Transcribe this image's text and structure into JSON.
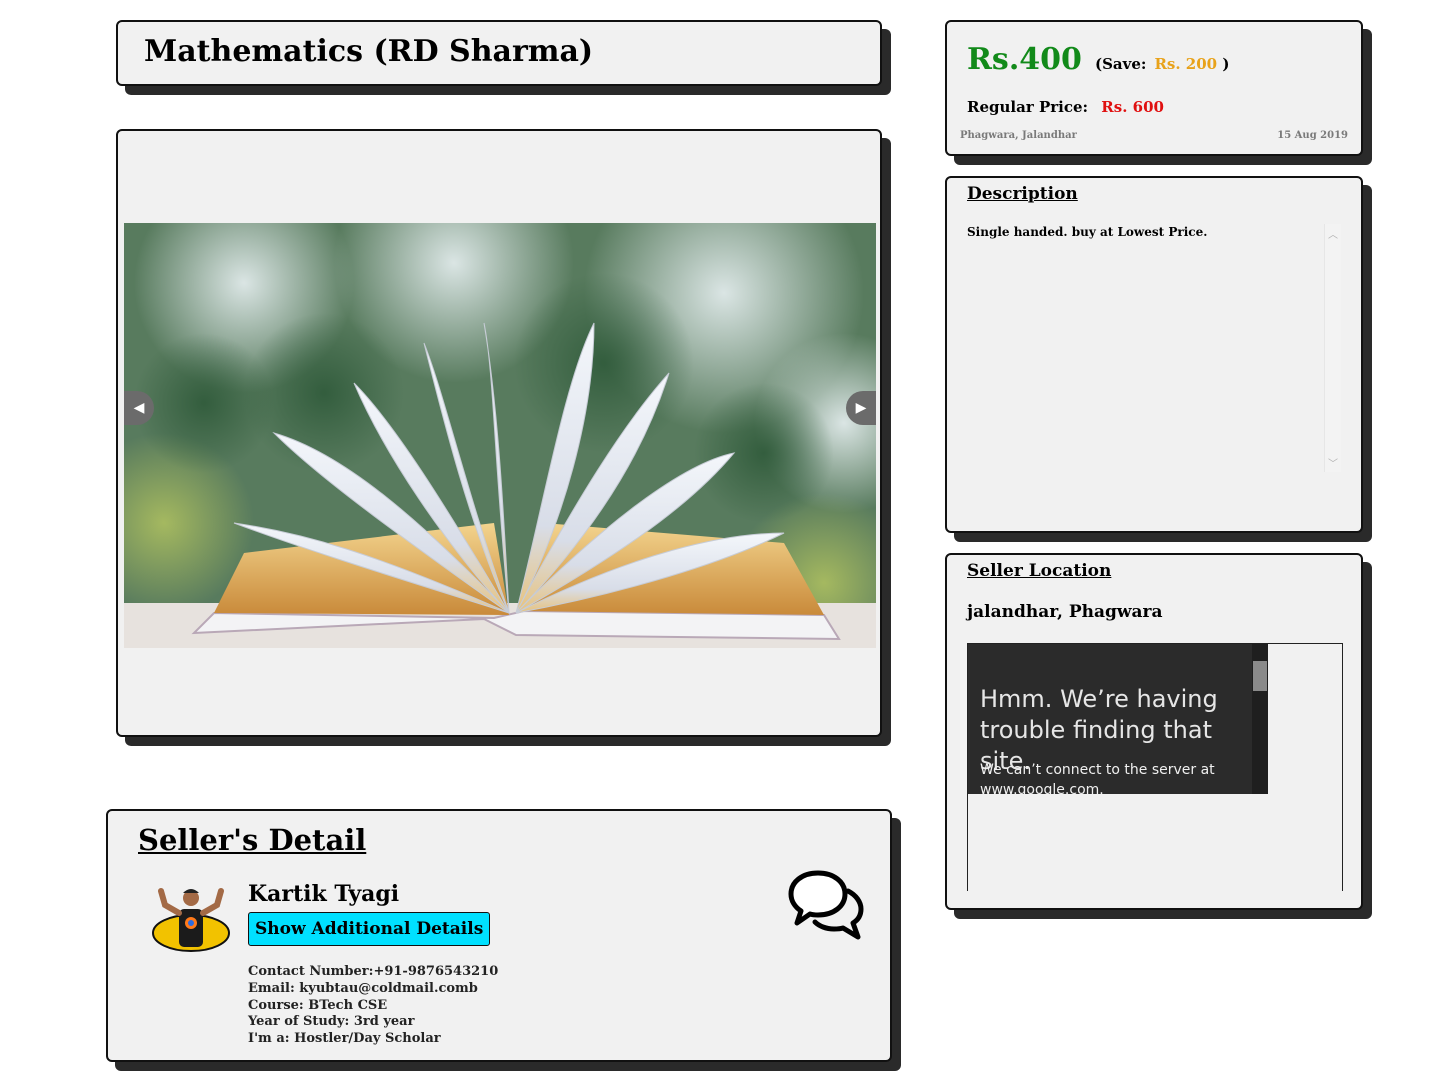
{
  "listing": {
    "title": "Mathematics (RD Sharma)"
  },
  "carousel": {
    "image_alt": "open book",
    "prev_label": "◀",
    "next_label": "▶"
  },
  "price": {
    "current": "Rs.400",
    "save_label": "(Save:",
    "save_amount": "Rs. 200",
    "save_close": ")",
    "regular_label": "Regular Price:",
    "regular_amount": "Rs. 600",
    "location": "Phagwara, Jalandhar",
    "date": "15 Aug 2019",
    "colors": {
      "current": "#128a1a",
      "save": "#e8a21a",
      "regular": "#e01010"
    }
  },
  "description": {
    "heading": "Description",
    "text": "Single handed. buy at Lowest Price."
  },
  "location": {
    "heading": "Seller Location",
    "text": "jalandhar, Phagwara",
    "map_error_title": "Hmm. We’re having trouble finding that site.",
    "map_error_body": "We can’t connect to the server at www.google.com."
  },
  "seller": {
    "heading": "Seller's Detail",
    "name": "Kartik Tyagi",
    "button_label": "Show Additional Details",
    "button_color": "#00e0ff",
    "details": [
      "Contact Number:+91-9876543210",
      "Email: kyubtau@coldmail.comb",
      "Course: BTech CSE",
      "Year of Study: 3rd year",
      "I'm a: Hostler/Day Scholar"
    ],
    "chat_icon": "chat-bubbles-icon"
  }
}
